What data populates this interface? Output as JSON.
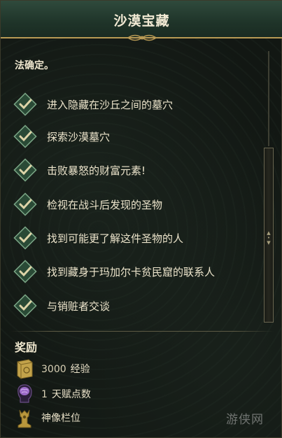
{
  "header": {
    "title": "沙漠宝藏"
  },
  "quest": {
    "text": "法确定。"
  },
  "objectives": [
    {
      "label": "进入隐藏在沙丘之间的墓穴",
      "done": true
    },
    {
      "label": "探索沙漠墓穴",
      "done": true
    },
    {
      "label": "击败暴怒的财富元素!",
      "done": true
    },
    {
      "label": "检视在战斗后发现的圣物",
      "done": true
    },
    {
      "label": "找到可能更了解这件圣物的人",
      "done": true
    },
    {
      "label": "找到藏身于玛加尔卡贫民窟的联系人",
      "done": true
    },
    {
      "label": "与销赃者交谈",
      "done": true
    }
  ],
  "rewards": {
    "title": "奖励",
    "items": [
      {
        "icon": "experience-book-icon",
        "amount": "3000",
        "label": "经验"
      },
      {
        "icon": "brain-head-icon",
        "amount": "1",
        "label": "天赋点数"
      },
      {
        "icon": "idol-statue-icon",
        "amount": "",
        "label": "神像栏位"
      }
    ]
  },
  "watermark": {
    "text": "游侠网"
  },
  "colors": {
    "header": "#1f3429",
    "accent_gold": "#b89a55",
    "check_green": "#2e5a3e"
  }
}
